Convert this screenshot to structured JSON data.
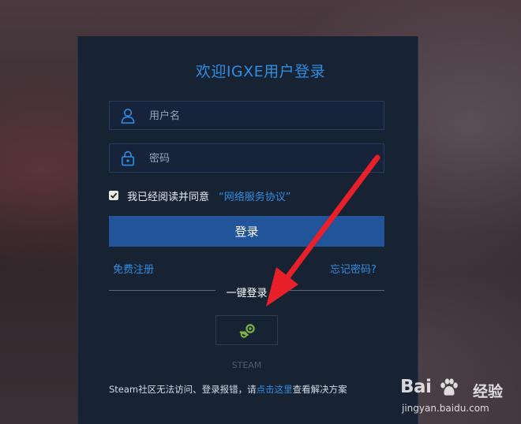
{
  "page": {
    "title": "欢迎IGXE用户登录"
  },
  "form": {
    "username_placeholder": "用户名",
    "password_placeholder": "密码",
    "agree_text": "我已经阅读并同意",
    "agreement_link": "“网络服务协议”",
    "agree_checked": true,
    "login_button": "登录",
    "register_link": "免费注册",
    "forgot_link": "忘记密码?"
  },
  "third_party": {
    "divider_label": "一键登录",
    "steam_label": "STEAM",
    "steam_icon": "steam-icon"
  },
  "help": {
    "prefix": "Steam社区无法访问、登录报错，请",
    "link": "点击这里",
    "suffix": "查看解决方案"
  },
  "watermark": {
    "brand": "Bai",
    "brand_suffix": "经验",
    "url": "jingyan.baidu.com"
  },
  "colors": {
    "accent": "#2d8fe0",
    "panel": "#172233",
    "button": "#22549a",
    "arrow": "#e8202a"
  }
}
